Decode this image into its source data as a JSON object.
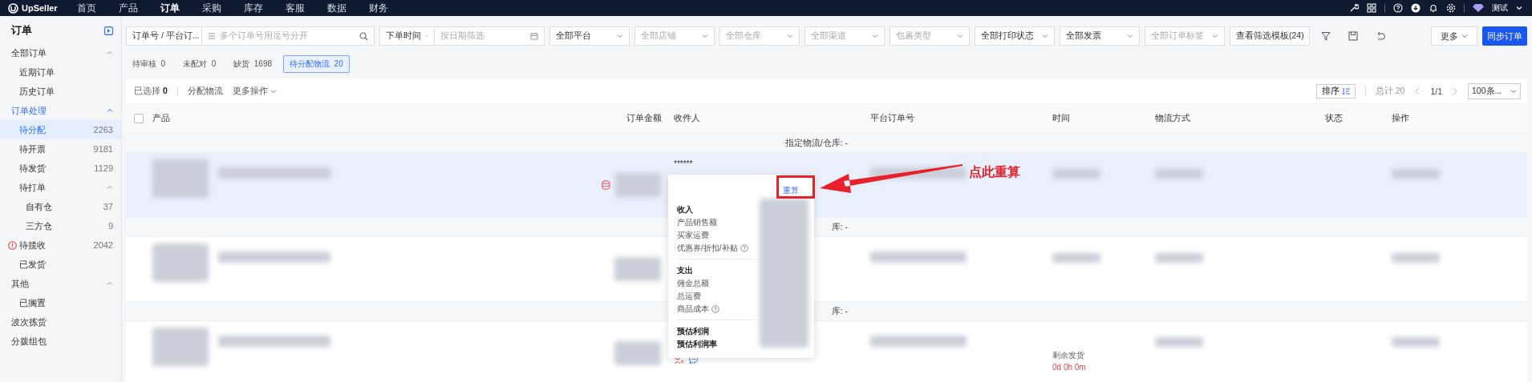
{
  "brand": "UpSeller",
  "nav": [
    {
      "label": "首页",
      "selected": false
    },
    {
      "label": "产品",
      "selected": false
    },
    {
      "label": "订单",
      "selected": true
    },
    {
      "label": "采购",
      "selected": false
    },
    {
      "label": "库存",
      "selected": false
    },
    {
      "label": "客服",
      "selected": false
    },
    {
      "label": "数据",
      "selected": false
    },
    {
      "label": "财务",
      "selected": false
    }
  ],
  "user": "测试",
  "sidebar": {
    "title": "订单",
    "items": [
      {
        "label": "全部订单",
        "expanded": true,
        "children": [
          {
            "label": "近期订单",
            "selected": false
          },
          {
            "label": "历史订单",
            "selected": false
          }
        ]
      },
      {
        "label": "订单处理",
        "expanded": true,
        "children": [
          {
            "label": "待分配",
            "count": "2263",
            "selected": true
          },
          {
            "label": "待开票",
            "count": "9181",
            "selected": false
          },
          {
            "label": "待发货",
            "count": "1129",
            "selected": false
          },
          {
            "label": "待打单",
            "expanded": true,
            "children": [
              {
                "label": "自有仓",
                "count": "37",
                "selected": false
              },
              {
                "label": "三方仓",
                "count": "9",
                "selected": false
              }
            ]
          },
          {
            "label": "待揽收",
            "count": "2042",
            "warning": true,
            "selected": false
          },
          {
            "label": "已发货",
            "selected": false
          }
        ]
      },
      {
        "label": "其他",
        "expanded": true,
        "children": [
          {
            "label": "已搁置",
            "selected": false
          }
        ]
      },
      {
        "label": "波次拣货",
        "selected": false
      },
      {
        "label": "分拨组包",
        "selected": false
      }
    ]
  },
  "filters": [
    [
      {
        "kind": "select",
        "value": "订单号 / 平台订..."
      },
      {
        "kind": "search",
        "placeholder": "多个订单号用逗号分开"
      }
    ],
    [
      {
        "kind": "select",
        "value": "下单时间"
      },
      {
        "kind": "date",
        "placeholder": "按日期筛选"
      }
    ],
    [
      {
        "kind": "select",
        "value": "全部平台"
      }
    ],
    [
      {
        "kind": "select",
        "placeholder": "全部店铺"
      }
    ],
    [
      {
        "kind": "select",
        "placeholder": "全部仓库"
      }
    ],
    [
      {
        "kind": "select",
        "placeholder": "全部渠道"
      }
    ],
    [
      {
        "kind": "select",
        "placeholder": "包裹类型"
      }
    ],
    [
      {
        "kind": "select",
        "value": "全部打印状态"
      }
    ],
    [
      {
        "kind": "select",
        "value": "全部发票"
      }
    ],
    [
      {
        "kind": "select",
        "placeholder": "全部订单标签"
      }
    ],
    [
      {
        "kind": "select",
        "value": "查看筛选模板(24)"
      }
    ]
  ],
  "more_button": "更多",
  "sync_button": "同步订单",
  "status_tabs": [
    {
      "label": "待审核",
      "count": "0",
      "selected": false
    },
    {
      "label": "未配对",
      "count": "0",
      "selected": false
    },
    {
      "label": "缺货",
      "count": "1698",
      "selected": false
    },
    {
      "label": "待分配物流",
      "count": "20",
      "selected": true
    }
  ],
  "toolbar": {
    "selected_label": "已选择",
    "selected_count": "0",
    "actions": [
      "分配物流",
      "更多操作"
    ],
    "sort": "排序",
    "total": "总计 20",
    "page": "1/1",
    "page_size": "100条..."
  },
  "select_all": {
    "checked": false
  },
  "columns": [
    "产品",
    "订单金额",
    "收件人",
    "平台订单号",
    "时间",
    "物流方式",
    "状态",
    "操作"
  ],
  "rows": [
    {
      "header": "指定物流/仓库: -",
      "highlighted": true,
      "warehouse_icon": true,
      "recipient": "******"
    },
    {
      "header": "库: -",
      "highlighted": false
    },
    {
      "header": "库: -",
      "highlighted": false,
      "contact_icons": true,
      "timer": {
        "label": "剩余发货",
        "value": "0d 0h 0m"
      }
    }
  ],
  "popover": {
    "recalc": "重算",
    "sections": [
      {
        "title": "收入",
        "items": [
          {
            "label": "产品销售额"
          },
          {
            "label": "买家运费"
          },
          {
            "label": "优惠券/折扣/补贴",
            "help": true
          }
        ]
      },
      {
        "title": "支出",
        "items": [
          {
            "label": "佣金总额"
          },
          {
            "label": "总运费"
          },
          {
            "label": "商品成本",
            "help": true
          }
        ]
      }
    ],
    "totals": [
      "预估利润",
      "预估利润率"
    ]
  },
  "annotation": "点此重算"
}
